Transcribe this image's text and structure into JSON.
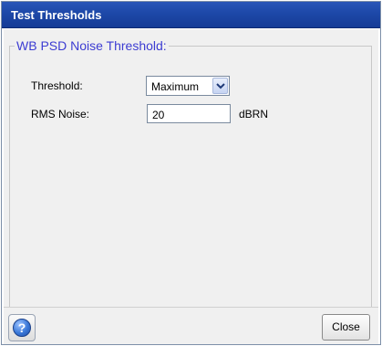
{
  "window": {
    "title": "Test Thresholds"
  },
  "group": {
    "legend": "WB PSD Noise Threshold:"
  },
  "threshold": {
    "label": "Threshold:",
    "selected": "Maximum"
  },
  "rms_noise": {
    "label": "RMS Noise:",
    "value": "20",
    "unit": "dBRN"
  },
  "footer": {
    "help_icon": "help-icon",
    "close_label": "Close"
  },
  "colors": {
    "titlebar": "#1d48a8",
    "legend_text": "#3c3cd2",
    "panel": "#f0f0f0"
  }
}
